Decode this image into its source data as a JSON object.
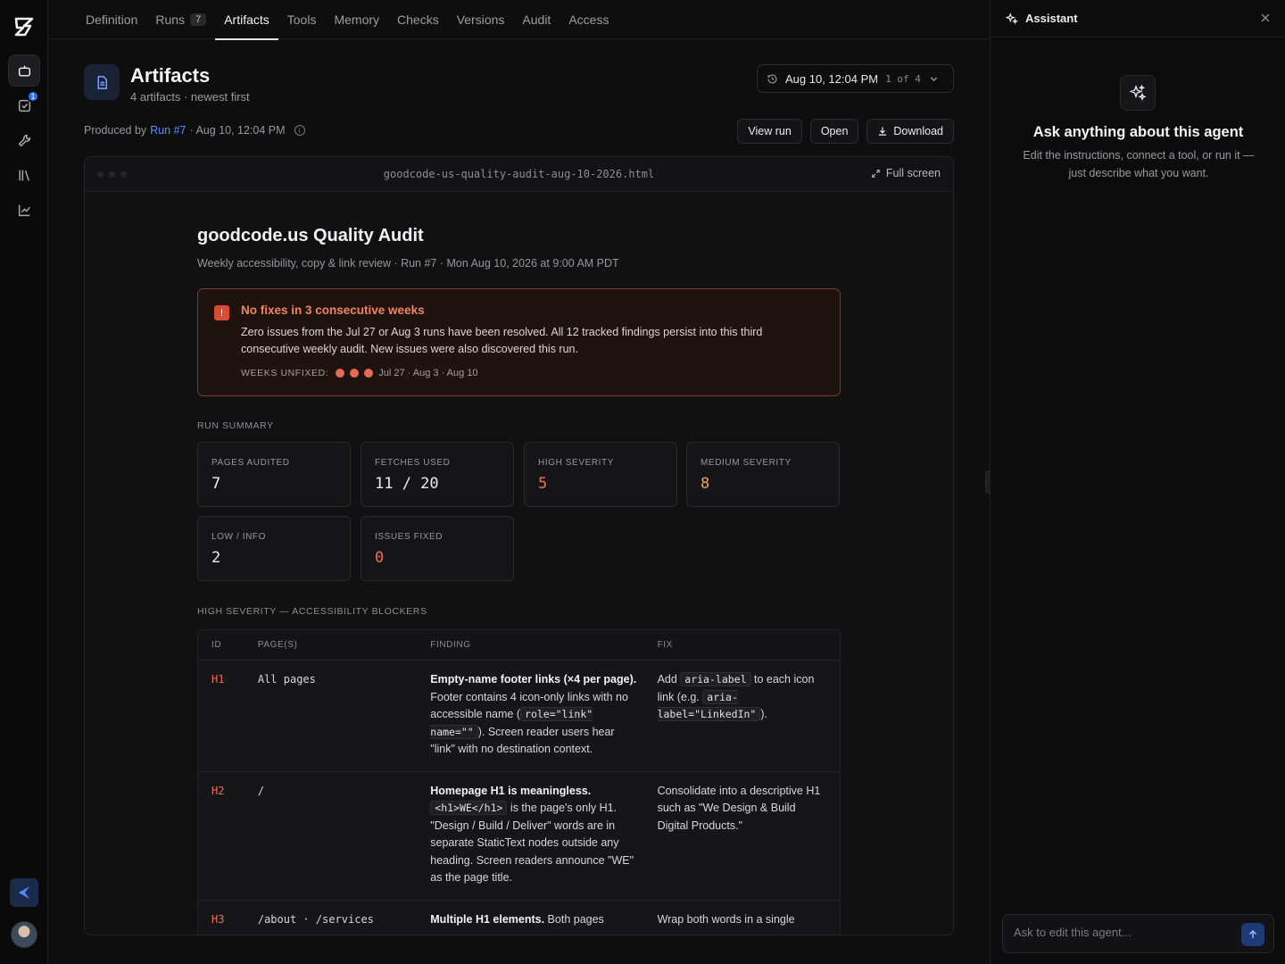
{
  "tabs": [
    {
      "label": "Definition"
    },
    {
      "label": "Runs",
      "count": "7"
    },
    {
      "label": "Artifacts"
    },
    {
      "label": "Tools"
    },
    {
      "label": "Memory"
    },
    {
      "label": "Checks"
    },
    {
      "label": "Versions"
    },
    {
      "label": "Audit"
    },
    {
      "label": "Access"
    }
  ],
  "rail": {
    "checks_badge": "1"
  },
  "header": {
    "title": "Artifacts",
    "subtitle": "4 artifacts · newest first",
    "version_date": "Aug 10, 12:04 PM",
    "version_position": "1 of 4",
    "produced_prefix": "Produced by",
    "produced_run": "Run #7",
    "produced_time": "· Aug 10, 12:04 PM",
    "view_run": "View run",
    "open": "Open",
    "download": "Download"
  },
  "frame": {
    "filename": "goodcode-us-quality-audit-aug-10-2026.html",
    "full_screen": "Full screen"
  },
  "report": {
    "title": "goodcode.us Quality Audit",
    "subtitle": "Weekly accessibility, copy & link review · Run #7 · Mon Aug 10, 2026 at 9:00 AM PDT",
    "alert": {
      "title": "No fixes in 3 consecutive weeks",
      "body": "Zero issues from the Jul 27 or Aug 3 runs have been resolved. All 12 tracked findings persist into this third consecutive weekly audit. New issues were also discovered this run.",
      "weeks_label": "WEEKS UNFIXED:",
      "weeks": "Jul 27 · Aug 3 · Aug 10"
    },
    "summary_label": "RUN SUMMARY",
    "stats": [
      {
        "label": "PAGES AUDITED",
        "value": "7"
      },
      {
        "label": "FETCHES USED",
        "value": "11 / 20"
      },
      {
        "label": "HIGH SEVERITY",
        "value": "5"
      },
      {
        "label": "MEDIUM SEVERITY",
        "value": "8"
      },
      {
        "label": "LOW / INFO",
        "value": "2"
      },
      {
        "label": "ISSUES FIXED",
        "value": "0"
      }
    ],
    "high_label": "HIGH SEVERITY — ACCESSIBILITY BLOCKERS",
    "columns": [
      "ID",
      "PAGE(S)",
      "FINDING",
      "FIX"
    ],
    "rows": [
      {
        "id": "H1",
        "pages": "All pages",
        "finding_bold": "Empty-name footer links (×4 per page).",
        "finding_a": " Footer contains 4 icon-only links with no accessible name (",
        "finding_code": "role=\"link\" name=\"\"",
        "finding_b": "). Screen reader users hear \"link\" with no destination context.",
        "fix_a": "Add ",
        "fix_code1": "aria-label",
        "fix_b": " to each icon link (e.g. ",
        "fix_code2": "aria-label=\"LinkedIn\"",
        "fix_c": ")."
      },
      {
        "id": "H2",
        "pages": "/",
        "finding_bold": "Homepage H1 is meaningless.",
        "finding_code": "<h1>WE</h1>",
        "finding_b": " is the page's only H1. \"Design / Build / Deliver\" words are in separate StaticText nodes outside any heading. Screen readers announce \"WE\" as the page title.",
        "fix": "Consolidate into a descriptive H1 such as \"We Design & Build Digital Products.\""
      },
      {
        "id": "H3",
        "pages": "/about · /services",
        "finding_bold": "Multiple H1 elements.",
        "finding_b": " Both pages",
        "fix": "Wrap both words in a single"
      }
    ]
  },
  "assistant": {
    "title": "Assistant",
    "headline": "Ask anything about this agent",
    "subtitle": "Edit the instructions, connect a tool, or run it — just describe what you want.",
    "placeholder": "Ask to edit this agent..."
  }
}
